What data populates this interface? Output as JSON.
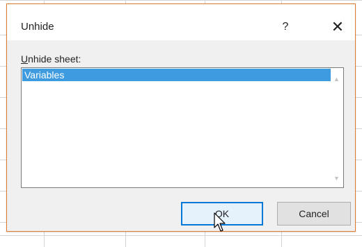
{
  "dialog": {
    "title": "Unhide",
    "help_label": "?",
    "close_label": "✕"
  },
  "list": {
    "label_accel": "U",
    "label_rest": "nhide sheet:",
    "items": [
      "Variables"
    ],
    "selected_index": 0
  },
  "buttons": {
    "ok_label": "OK",
    "cancel_label": "Cancel"
  },
  "colors": {
    "dialog_border": "#e07a2c",
    "selection": "#3e9be0",
    "default_button_border": "#0078d7"
  }
}
